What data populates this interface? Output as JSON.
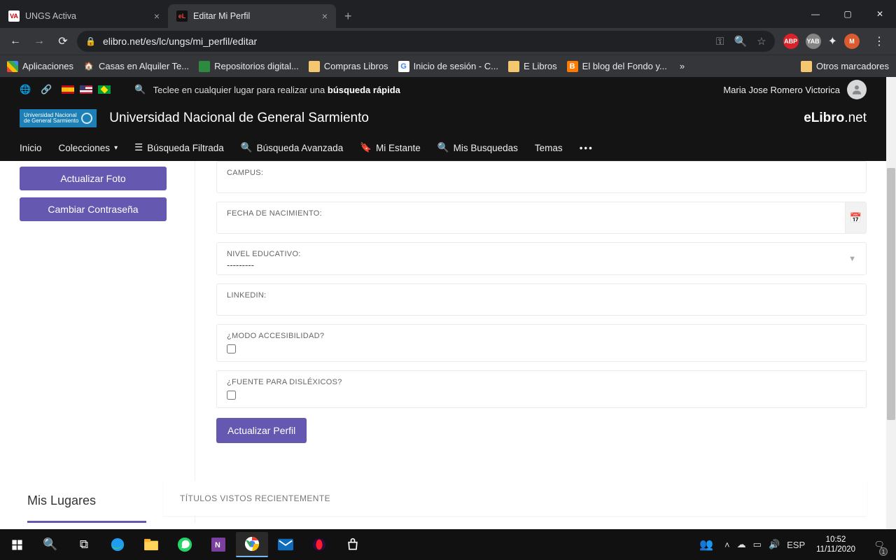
{
  "browser": {
    "tabs": [
      {
        "favicon": "VA",
        "title": "UNGS Activa",
        "active": false
      },
      {
        "favicon": "eL",
        "title": "Editar Mi Perfil",
        "active": true
      }
    ],
    "url": "elibro.net/es/lc/ungs/mi_perfil/editar",
    "bookmarks": {
      "apps": "Aplicaciones",
      "items": [
        {
          "icon": "casa",
          "label": "Casas en Alquiler Te..."
        },
        {
          "icon": "repo",
          "label": "Repositorios digital..."
        },
        {
          "icon": "folder",
          "label": "Compras Libros"
        },
        {
          "icon": "g",
          "label": "Inicio de sesión - C..."
        },
        {
          "icon": "folder",
          "label": "E Libros"
        },
        {
          "icon": "b",
          "label": "El blog del Fondo y..."
        }
      ],
      "more": "»",
      "other": "Otros marcadores"
    },
    "profile_letter": "M"
  },
  "elibro": {
    "search_hint_pre": "Teclee en cualquier lugar para realizar una ",
    "search_hint_bold": "búsqueda rápida",
    "user_name": "Maria Jose Romero Victorica",
    "uni_badge_l1": "Universidad Nacional",
    "uni_badge_l2": "de General Sarmiento",
    "university": "Universidad Nacional de General Sarmiento",
    "logo_a": "eLibro",
    "logo_b": ".net",
    "nav": {
      "inicio": "Inicio",
      "colecciones": "Colecciones",
      "busq_filtrada": "Búsqueda Filtrada",
      "busq_avanzada": "Búsqueda Avanzada",
      "mi_estante": "Mi Estante",
      "mis_busq": "Mis Busquedas",
      "temas": "Temas"
    },
    "side": {
      "update_photo": "Actualizar Foto",
      "change_pw": "Cambiar Contraseña"
    },
    "form": {
      "campus_label": "CAMPUS:",
      "dob_label": "FECHA DE NACIMIENTO:",
      "edu_label": "NIVEL EDUCATIVO:",
      "edu_value": "---------",
      "linkedin_label": "LINKEDIN:",
      "access_label": "¿MODO ACCESIBILIDAD?",
      "dys_label": "¿FUENTE PARA DISLÉXICOS?",
      "submit": "Actualizar Perfil"
    },
    "mis_lugares": "Mis Lugares",
    "recent_titles": "TÍTULOS VISTOS RECIENTEMENTE"
  },
  "taskbar": {
    "lang": "ESP",
    "time": "10:52",
    "date": "11/11/2020",
    "notif_count": "1"
  }
}
